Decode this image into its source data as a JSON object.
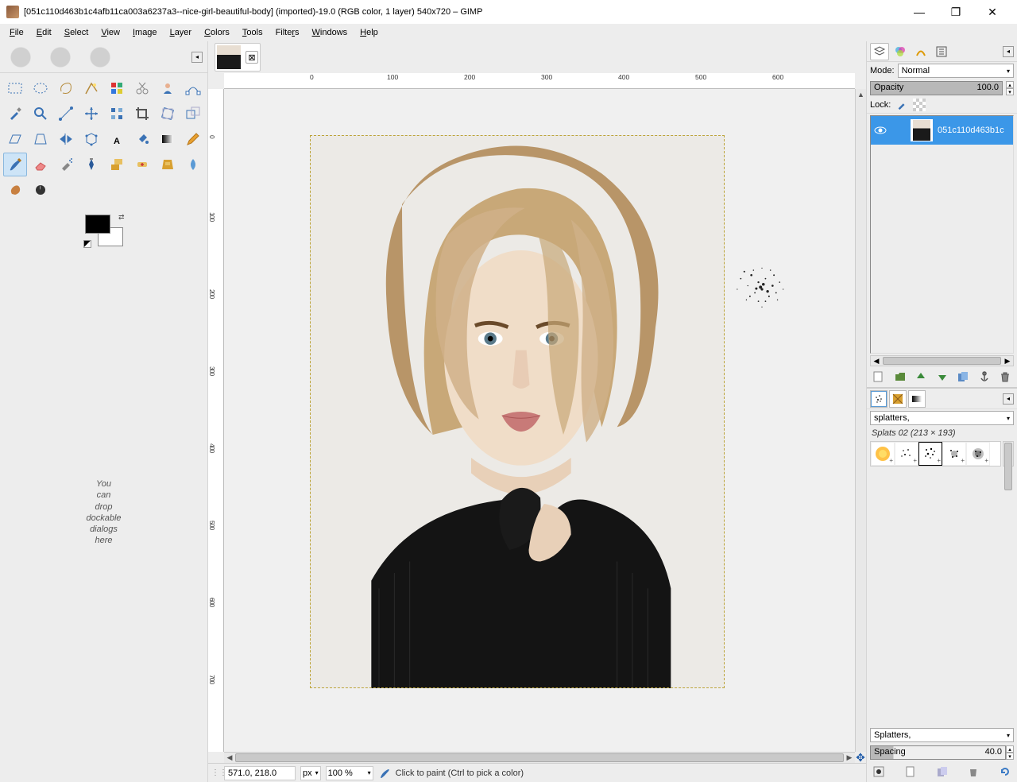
{
  "title": "[051c110d463b1c4afb11ca003a6237a3--nice-girl-beautiful-body] (imported)-19.0 (RGB color, 1 layer) 540x720 – GIMP",
  "menu": [
    "File",
    "Edit",
    "Select",
    "View",
    "Image",
    "Layer",
    "Colors",
    "Tools",
    "Filters",
    "Windows",
    "Help"
  ],
  "drop_hint": [
    "You",
    "can",
    "drop",
    "dockable",
    "dialogs",
    "here"
  ],
  "h_ruler_ticks": [
    "0",
    "100",
    "200",
    "300",
    "400",
    "500",
    "600"
  ],
  "v_ruler_ticks": [
    "0",
    "100",
    "200",
    "300",
    "400",
    "500",
    "600",
    "700"
  ],
  "status": {
    "coords": "571.0, 218.0",
    "units": "px",
    "zoom": "100 %",
    "hint": "Click to paint (Ctrl to pick a color)"
  },
  "layers": {
    "mode_label": "Mode:",
    "mode_value": "Normal",
    "opacity_label": "Opacity",
    "opacity_value": "100.0",
    "lock_label": "Lock:",
    "layer_name": "051c110d463b1c"
  },
  "brushes": {
    "filter": "splatters,",
    "selected_info": "Splats 02 (213 × 193)",
    "category": "Splatters,",
    "spacing_label": "Spacing",
    "spacing_value": "40.0"
  }
}
